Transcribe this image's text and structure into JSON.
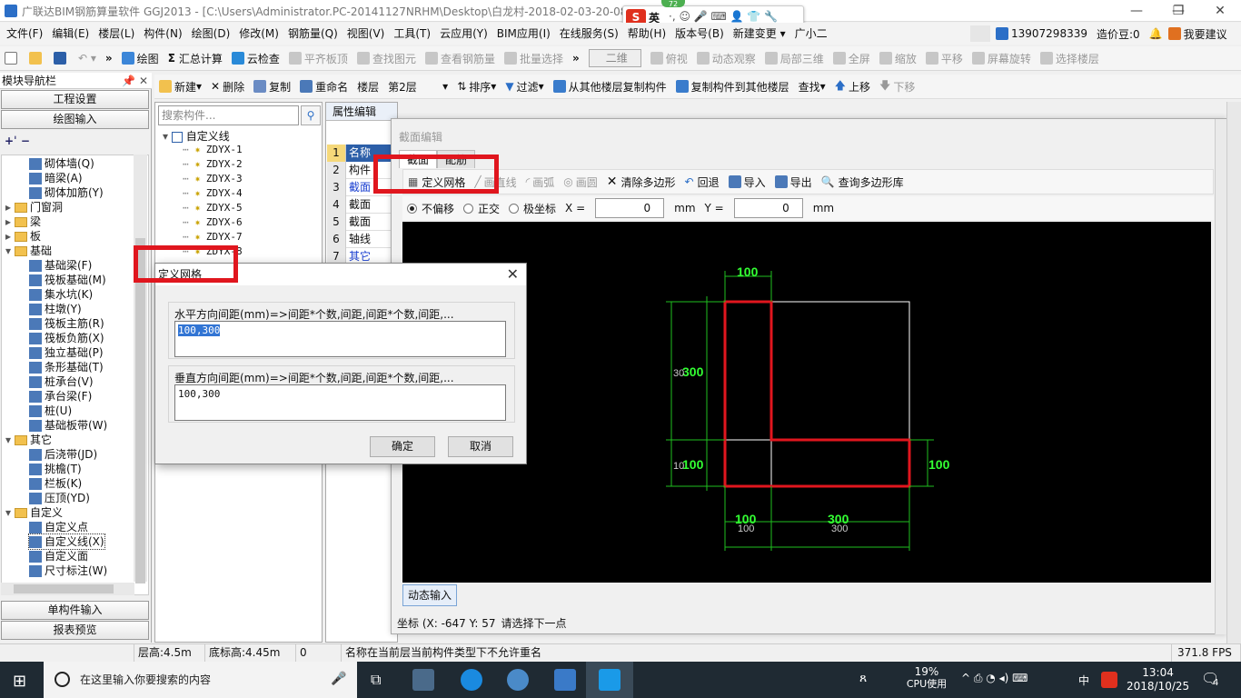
{
  "window": {
    "title": "广联达BIM钢筋算量软件 GGJ2013 - [C:\\Users\\Administrator.PC-20141127NRHM\\Desktop\\白龙村-2018-02-03-20-08",
    "minimize": "—",
    "restore": "❐",
    "close": "✕"
  },
  "ime": {
    "s": "S",
    "lang": "英",
    "badge": "72",
    "icons": "·, ☺ 🎤 ⌨ 👤 👕 🔧"
  },
  "menu": [
    "文件(F)",
    "编辑(E)",
    "楼层(L)",
    "构件(N)",
    "绘图(D)",
    "修改(M)",
    "钢筋量(Q)",
    "视图(V)",
    "工具(T)",
    "云应用(Y)",
    "BIM应用(I)",
    "在线服务(S)",
    "帮助(H)",
    "版本号(B)",
    "新建变更 ▾",
    "广小二"
  ],
  "account": {
    "phone": "13907298339",
    "beans": "造价豆:0",
    "suggest": "我要建议"
  },
  "toolbar1": {
    "draw": "绘图",
    "sum": "汇总计算",
    "cloud_check": "云检查",
    "align_top": "平齐板顶",
    "find": "查找图元",
    "view_steel": "查看钢筋量",
    "batch": "批量选择",
    "view2d": "二维",
    "top_view": "俯视",
    "dyn_view": "动态观察",
    "local3d": "局部三维",
    "fullscreen": "全屏",
    "zoom": "缩放",
    "pan": "平移",
    "rotate": "屏幕旋转",
    "select_floor": "选择楼层"
  },
  "nav": {
    "title": "模块导航栏",
    "pin": "📌 ✕",
    "engineering": "工程设置",
    "draw_input": "绘图输入",
    "single_input": "单构件输入",
    "report": "报表预览",
    "tree": [
      {
        "label": "砌体墙(Q)",
        "level": 2
      },
      {
        "label": "暗梁(A)",
        "level": 2
      },
      {
        "label": "砌体加筋(Y)",
        "level": 2
      },
      {
        "label": "门窗洞",
        "level": 1,
        "folder": true,
        "exp": "▸"
      },
      {
        "label": "梁",
        "level": 1,
        "folder": true,
        "exp": "▸"
      },
      {
        "label": "板",
        "level": 1,
        "folder": true,
        "exp": "▸"
      },
      {
        "label": "基础",
        "level": 1,
        "folder": true,
        "exp": "▾"
      },
      {
        "label": "基础梁(F)",
        "level": 2
      },
      {
        "label": "筏板基础(M)",
        "level": 2
      },
      {
        "label": "集水坑(K)",
        "level": 2
      },
      {
        "label": "柱墩(Y)",
        "level": 2
      },
      {
        "label": "筏板主筋(R)",
        "level": 2
      },
      {
        "label": "筏板负筋(X)",
        "level": 2
      },
      {
        "label": "独立基础(P)",
        "level": 2
      },
      {
        "label": "条形基础(T)",
        "level": 2
      },
      {
        "label": "桩承台(V)",
        "level": 2
      },
      {
        "label": "承台梁(F)",
        "level": 2
      },
      {
        "label": "桩(U)",
        "level": 2
      },
      {
        "label": "基础板带(W)",
        "level": 2
      },
      {
        "label": "其它",
        "level": 1,
        "folder": true,
        "exp": "▾"
      },
      {
        "label": "后浇带(JD)",
        "level": 2
      },
      {
        "label": "挑檐(T)",
        "level": 2
      },
      {
        "label": "栏板(K)",
        "level": 2
      },
      {
        "label": "压顶(YD)",
        "level": 2
      },
      {
        "label": "自定义",
        "level": 1,
        "folder": true,
        "exp": "▾"
      },
      {
        "label": "自定义点",
        "level": 2
      },
      {
        "label": "自定义线(X)",
        "level": 2,
        "selected": true
      },
      {
        "label": "自定义面",
        "level": 2
      },
      {
        "label": "尺寸标注(W)",
        "level": 2
      }
    ]
  },
  "comp_toolbar": {
    "new": "新建",
    "delete": "删除",
    "copy": "复制",
    "rename": "重命名",
    "floor_label": "楼层",
    "floor": "第2层",
    "sort": "排序",
    "filter": "过滤",
    "copy_from": "从其他楼层复制构件",
    "copy_to": "复制构件到其他楼层",
    "find": "查找",
    "up": "上移",
    "down": "下移"
  },
  "complist": {
    "search_placeholder": "搜索构件...",
    "root": "自定义线",
    "items": [
      "ZDYX-1",
      "ZDYX-2",
      "ZDYX-3",
      "ZDYX-4",
      "ZDYX-5",
      "ZDYX-6",
      "ZDYX-7",
      "ZDYX-8"
    ]
  },
  "props": {
    "tab": "属性编辑",
    "rows": [
      {
        "n": "1",
        "v": "名称",
        "hl": true
      },
      {
        "n": "2",
        "v": "构件"
      },
      {
        "n": "3",
        "v": "截面",
        "blue": true
      },
      {
        "n": "4",
        "v": "截面"
      },
      {
        "n": "5",
        "v": "截面"
      },
      {
        "n": "6",
        "v": "轴线"
      },
      {
        "n": "7",
        "v": "其它",
        "blue": true
      }
    ]
  },
  "section_editor": {
    "title": "截面编辑",
    "tabs": [
      "截面",
      "配筋"
    ],
    "toolbar": {
      "grid": "定义网格",
      "line": "画直线",
      "arc": "画弧",
      "circle": "画圆",
      "clear": "清除多边形",
      "undo": "回退",
      "import": "导入",
      "export": "导出",
      "query": "查询多边形库"
    },
    "options": {
      "no_offset": "不偏移",
      "ortho": "正交",
      "polar": "极坐标",
      "x_label": "X =",
      "x_val": "0",
      "unit_x": "mm",
      "y_label": "Y =",
      "y_val": "0",
      "unit_y": "mm"
    },
    "dyn_input": "动态输入",
    "coord": "坐标 (X: -647 Y: 57",
    "status": "请选择下一点"
  },
  "drawing": {
    "dims": {
      "top": "100",
      "left_top": "300",
      "left_top_small": "30",
      "left_bottom": "100",
      "left_bottom_small": "10",
      "right": "100",
      "bottom_a": "100",
      "bottom_a_small": "100",
      "bottom_b": "300",
      "bottom_b_small": "300"
    },
    "grid_h": [
      100,
      300
    ],
    "grid_v": [
      100,
      300
    ],
    "colors": {
      "dim": "#1fbf1f",
      "dimtext": "#33ff33",
      "shape": "#e0161e",
      "grid": "#ffffff"
    }
  },
  "dialog": {
    "title": "定义网格",
    "close": "✕",
    "h_label": "水平方向间距(mm)=>间距*个数,间距,间距*个数,间距,...",
    "h_value": "100,300",
    "v_label": "垂直方向间距(mm)=>间距*个数,间距,间距*个数,间距,...",
    "v_value": "100,300",
    "ok": "确定",
    "cancel": "取消"
  },
  "statusbar": {
    "floor_h": "层高:4.5m",
    "bottom_h": "底标高:4.45m",
    "zero": "0",
    "msg": "名称在当前层当前构件类型下不允许重名",
    "fps": "371.8 FPS"
  },
  "taskbar": {
    "search": "在这里输入你要搜索的内容",
    "cpu": "19%",
    "cpu_label": "CPU使用",
    "ime": "中",
    "time": "13:04",
    "date": "2018/10/25",
    "notif": "4"
  }
}
